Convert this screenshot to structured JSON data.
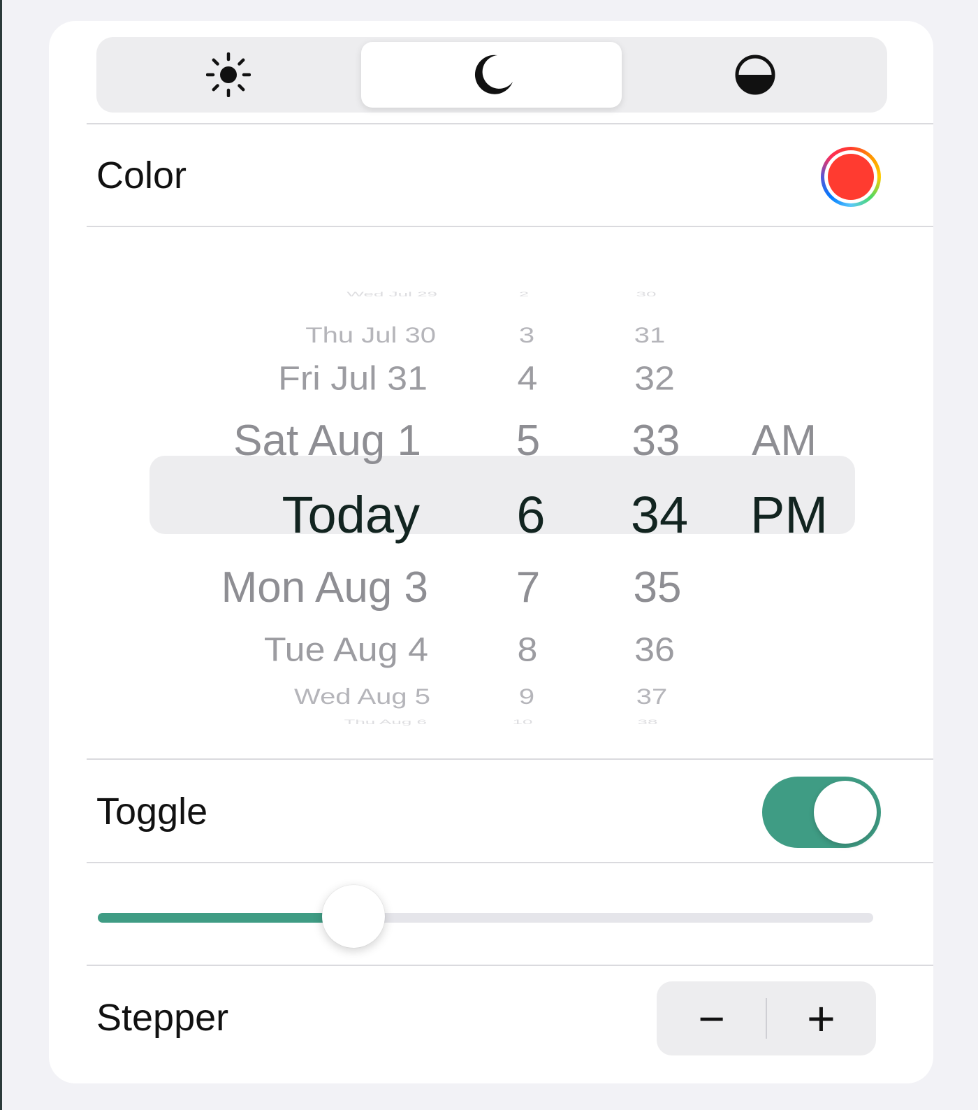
{
  "appearance_control": {
    "segments": [
      {
        "icon": "sun-icon",
        "selected": false
      },
      {
        "icon": "moon-icon",
        "selected": true
      },
      {
        "icon": "half-circle-icon",
        "selected": false
      }
    ]
  },
  "color_row": {
    "label": "Color",
    "value_color": "#ff3b30"
  },
  "date_picker": {
    "dates": [
      "Wed Jul 29",
      "Thu Jul 30",
      "Fri Jul 31",
      "Sat Aug 1",
      "Today",
      "Mon Aug 3",
      "Tue Aug 4",
      "Wed Aug 5",
      "Thu Aug 6"
    ],
    "hours": [
      "2",
      "3",
      "4",
      "5",
      "6",
      "7",
      "8",
      "9",
      "10"
    ],
    "minutes": [
      "30",
      "31",
      "32",
      "33",
      "34",
      "35",
      "36",
      "37",
      "38"
    ],
    "periods": [
      "AM",
      "PM"
    ],
    "selected": {
      "date": "Today",
      "hour": "6",
      "minute": "34",
      "period": "PM"
    }
  },
  "toggle_row": {
    "label": "Toggle",
    "on": true
  },
  "slider": {
    "value": 0.33
  },
  "stepper_row": {
    "label": "Stepper",
    "minus_label": "−",
    "plus_label": "+"
  },
  "colors": {
    "accent": "#3f9c84",
    "selected_text": "#122420",
    "faded_text": "#8e8e93"
  }
}
